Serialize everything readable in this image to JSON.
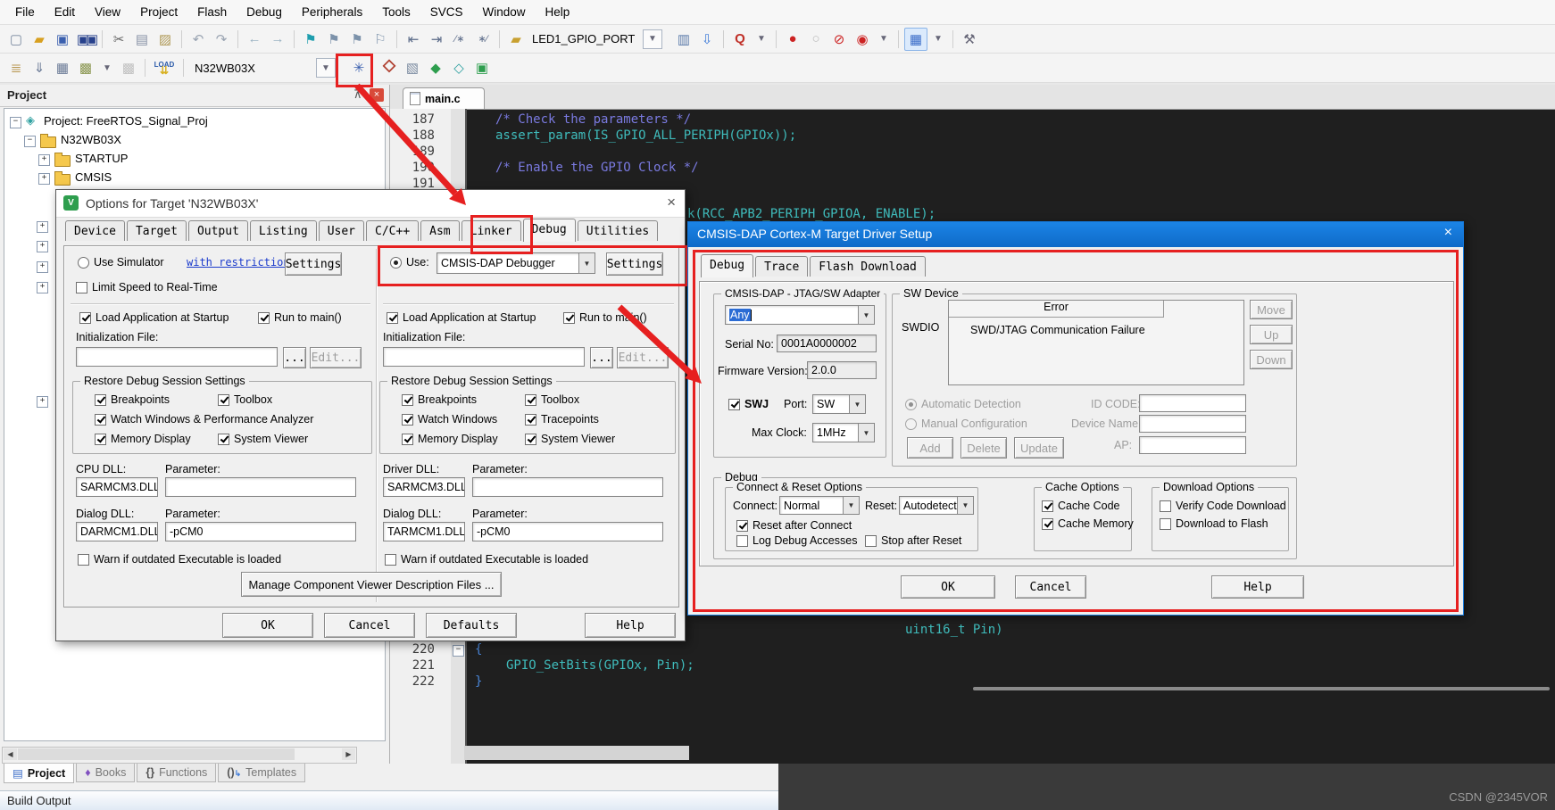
{
  "colors": {
    "annotation_red": "#e62020",
    "cmsis_titlebar_blue": "#1576d6",
    "editor_bg": "#1f1f1f",
    "comment_blue": "#7a7ae0",
    "code_cyan": "#3fbcbc",
    "selection_blue": "#2b6cd4"
  },
  "menu": {
    "items": [
      "File",
      "Edit",
      "View",
      "Project",
      "Flash",
      "Debug",
      "Peripherals",
      "Tools",
      "SVCS",
      "Window",
      "Help"
    ]
  },
  "tb": {
    "find": "LED1_GPIO_PORT",
    "target": "N32WB03X",
    "load": "LOAD"
  },
  "pp": {
    "title": "Project",
    "t1": "Project: FreeRTOS_Signal_Proj",
    "t2": "N32WB03X",
    "t3": "STARTUP",
    "t4": "CMSIS",
    "tabs": [
      "Project",
      "Books",
      "Functions",
      "Templates"
    ]
  },
  "ed": {
    "tab": "main.c",
    "top": [
      {
        "no": "187",
        "code": "/* Check the parameters */"
      },
      {
        "no": "188",
        "code": "assert_param(IS_GPIO_ALL_PERIPH(GPIOx));"
      },
      {
        "no": "189",
        "code": ""
      },
      {
        "no": "190",
        "code": "/* Enable the GPIO Clock */"
      },
      {
        "no": "191",
        "code": ""
      }
    ],
    "frag_rcc": "k(RCC_APB2_PERIPH_GPIOA, ENABLE);",
    "frag_pin": "uint16_t Pin)",
    "bottom": [
      {
        "no": "220",
        "code": "{"
      },
      {
        "no": "221",
        "code": "GPIO_SetBits(GPIOx, Pin);"
      },
      {
        "no": "222",
        "code": "}"
      }
    ]
  },
  "od": {
    "title": "Options for Target 'N32WB03X'",
    "tabs": [
      "Device",
      "Target",
      "Output",
      "Listing",
      "User",
      "C/C++",
      "Asm",
      "Linker",
      "Debug",
      "Utilities"
    ],
    "sim": {
      "label": "Use Simulator",
      "checked": false
    },
    "restrictions": "with restrictions",
    "settings": "Settings",
    "limit": {
      "label": "Limit Speed to Real-Time",
      "checked": false
    },
    "use": {
      "label": "Use:",
      "checked": true
    },
    "debugger": "CMSIS-DAP Debugger",
    "load_app": {
      "label": "Load Application at Startup",
      "checked": true
    },
    "run_main": {
      "label": "Run to main()",
      "checked": true
    },
    "init_label": "Initialization File:",
    "init_value": "",
    "browse": "...",
    "edit": "Edit...",
    "restore": "Restore Debug Session Settings",
    "left_cbs": [
      {
        "label": "Breakpoints",
        "checked": true
      },
      {
        "label": "Toolbox",
        "checked": true
      },
      {
        "label": "Watch Windows & Performance Analyzer",
        "checked": true
      },
      {
        "label": "Memory Display",
        "checked": true
      },
      {
        "label": "System Viewer",
        "checked": true
      }
    ],
    "right_cbs": [
      {
        "label": "Breakpoints",
        "checked": true
      },
      {
        "label": "Toolbox",
        "checked": true
      },
      {
        "label": "Watch Windows",
        "checked": true
      },
      {
        "label": "Tracepoints",
        "checked": true
      },
      {
        "label": "Memory Display",
        "checked": true
      },
      {
        "label": "System Viewer",
        "checked": true
      }
    ],
    "cpu_dll_label": "CPU DLL:",
    "param_label": "Parameter:",
    "cpu_dll": "SARMCM3.DLL",
    "cpu_param": "",
    "dialog_dll_label": "Dialog DLL:",
    "dialog_dll_l": "DARMCM1.DLL",
    "dialog_param_l": "-pCM0",
    "driver_dll_label": "Driver DLL:",
    "driver_dll": "SARMCM3.DLL",
    "driver_param": "",
    "dialog_dll_r": "TARMCM1.DLL",
    "dialog_param_r": "-pCM0",
    "warn": {
      "label": "Warn if outdated Executable is loaded",
      "checked": false
    },
    "manage": "Manage Component Viewer Description Files ...",
    "ok": "OK",
    "cancel": "Cancel",
    "defaults": "Defaults",
    "help": "Help"
  },
  "cd": {
    "title": "CMSIS-DAP Cortex-M Target Driver Setup",
    "tabs": [
      "Debug",
      "Trace",
      "Flash Download"
    ],
    "adapter_group": "CMSIS-DAP - JTAG/SW Adapter",
    "adapter": "Any",
    "serial_label": "Serial No:",
    "serial": "0001A0000002",
    "fw_label": "Firmware Version:",
    "fw": "2.0.0",
    "swj": {
      "label": "SWJ",
      "checked": true
    },
    "port_label": "Port:",
    "port": "SW",
    "clock_label": "Max Clock:",
    "clock": "1MHz",
    "swdev_group": "SW Device",
    "err_col": "Error",
    "swdio": "SWDIO",
    "err_text": "SWD/JTAG Communication Failure",
    "move": "Move",
    "up": "Up",
    "down": "Down",
    "auto": {
      "label": "Automatic Detection",
      "checked": true
    },
    "manual": {
      "label": "Manual Configuration",
      "checked": false
    },
    "idcode": "ID CODE:",
    "devname": "Device Name:",
    "add": "Add",
    "del": "Delete",
    "update": "Update",
    "ap": "AP:",
    "debug_group": "Debug",
    "cr_group": "Connect & Reset Options",
    "connect_label": "Connect:",
    "connect": "Normal",
    "reset_label": "Reset:",
    "reset": "Autodetect",
    "reset_after": {
      "label": "Reset after Connect",
      "checked": true
    },
    "log_debug": {
      "label": "Log Debug Accesses",
      "checked": false
    },
    "stop_after": {
      "label": "Stop after Reset",
      "checked": false
    },
    "cache_group": "Cache Options",
    "cache_code": {
      "label": "Cache Code",
      "checked": true
    },
    "cache_mem": {
      "label": "Cache Memory",
      "checked": true
    },
    "dl_group": "Download Options",
    "verify": {
      "label": "Verify Code Download",
      "checked": false
    },
    "dl_flash": {
      "label": "Download to Flash",
      "checked": false
    },
    "ok": "OK",
    "cancel": "Cancel",
    "help": "Help"
  },
  "sb": {
    "build": "Build Output",
    "watermark": "CSDN @2345VOR"
  }
}
